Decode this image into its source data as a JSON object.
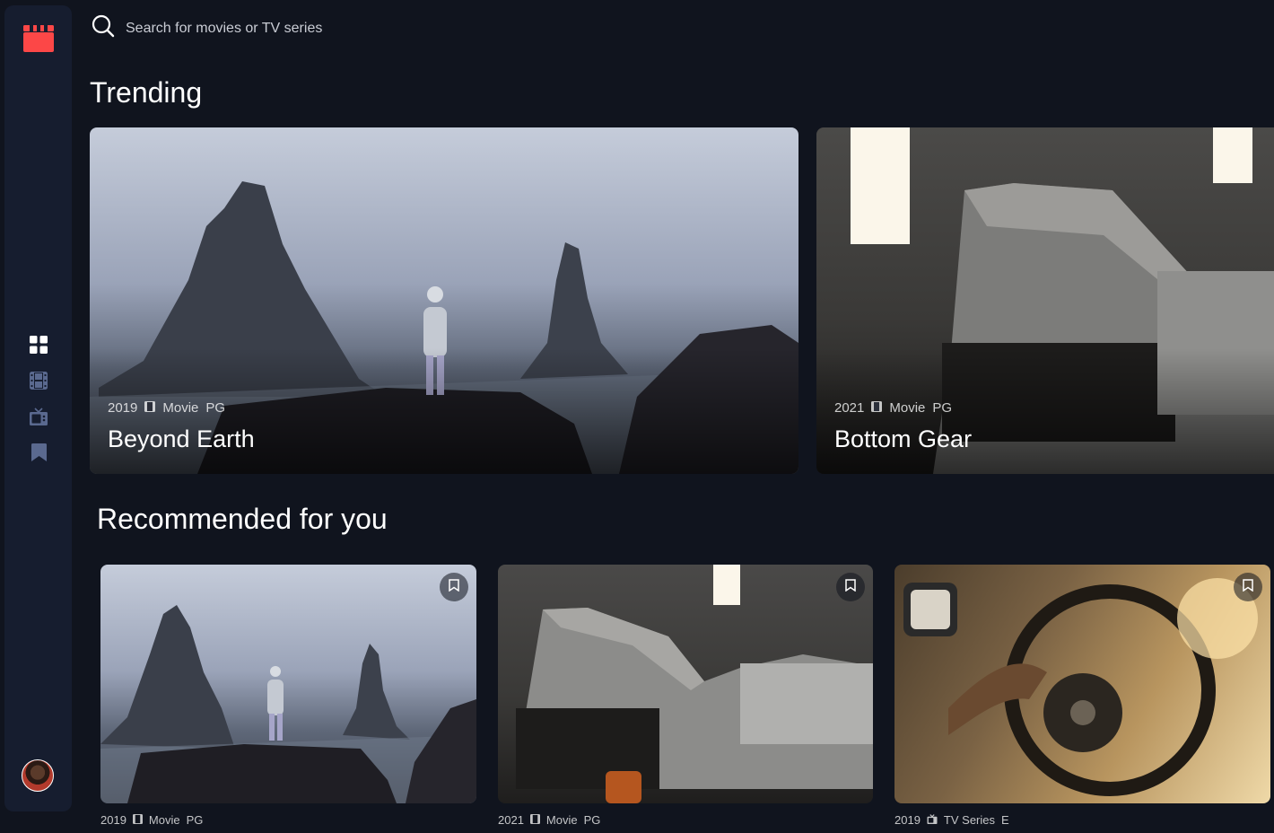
{
  "colors": {
    "background": "#10141e",
    "sidebar": "#161d2f",
    "accent": "#fc4747",
    "text": "#ffffff"
  },
  "icons": {
    "logo": "clapperboard-icon",
    "search": "search-icon",
    "nav": [
      "grid-icon",
      "film-icon",
      "tv-icon",
      "bookmark-icon"
    ],
    "bookmark": "bookmark-outline-icon",
    "movie": "film-icon",
    "tv": "tv-icon"
  },
  "search": {
    "placeholder": "Search for movies or TV series"
  },
  "trending": {
    "title": "Trending",
    "items": [
      {
        "year": "2019",
        "category": "Movie",
        "rating": "PG",
        "title": "Beyond Earth"
      },
      {
        "year": "2021",
        "category": "Movie",
        "rating": "PG",
        "title": "Bottom Gear"
      }
    ]
  },
  "recommended": {
    "title": "Recommended for you",
    "items": [
      {
        "year": "2019",
        "category": "Movie",
        "rating": "PG"
      },
      {
        "year": "2021",
        "category": "Movie",
        "rating": "PG"
      },
      {
        "year": "2019",
        "category": "TV Series",
        "rating": "E"
      }
    ]
  }
}
